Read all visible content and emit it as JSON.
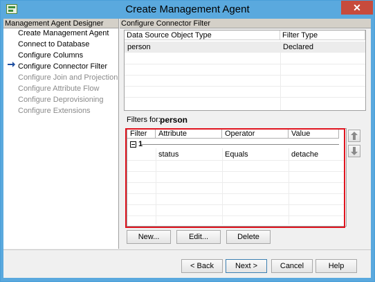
{
  "window": {
    "title": "Create Management Agent",
    "close_glyph": "✕"
  },
  "designer": {
    "header": "Management Agent Designer",
    "items": [
      {
        "label": "Create Management Agent",
        "enabled": true,
        "current": false
      },
      {
        "label": "Connect to Database",
        "enabled": true,
        "current": false
      },
      {
        "label": "Configure Columns",
        "enabled": true,
        "current": false
      },
      {
        "label": "Configure Connector Filter",
        "enabled": true,
        "current": true
      },
      {
        "label": "Configure Join and Projection Rules",
        "enabled": false,
        "current": false
      },
      {
        "label": "Configure Attribute Flow",
        "enabled": false,
        "current": false
      },
      {
        "label": "Configure Deprovisioning",
        "enabled": false,
        "current": false
      },
      {
        "label": "Configure Extensions",
        "enabled": false,
        "current": false
      }
    ],
    "current_icon": "right-arrow-icon"
  },
  "main": {
    "header": "Configure Connector Filter",
    "object_grid": {
      "columns": [
        "Data Source Object Type",
        "Filter Type"
      ],
      "rows": [
        [
          "person",
          "Declared"
        ]
      ]
    },
    "filters_label": "Filters for:",
    "filters_object": "person",
    "filter_grid": {
      "columns": [
        "Filter",
        "Attribute",
        "Operator",
        "Value"
      ],
      "group": "1",
      "rows": [
        [
          "",
          "status",
          "Equals",
          "detache"
        ]
      ]
    },
    "move_up_icon": "up-arrow-icon",
    "move_down_icon": "down-arrow-icon",
    "buttons": {
      "new": "New...",
      "edit": "Edit...",
      "delete": "Delete"
    }
  },
  "footer": {
    "back": "< Back",
    "next": "Next >",
    "cancel": "Cancel",
    "help": "Help"
  },
  "colors": {
    "titlebar": "#5aa9de",
    "close": "#c74b3c",
    "highlight_box": "#e0141e"
  }
}
